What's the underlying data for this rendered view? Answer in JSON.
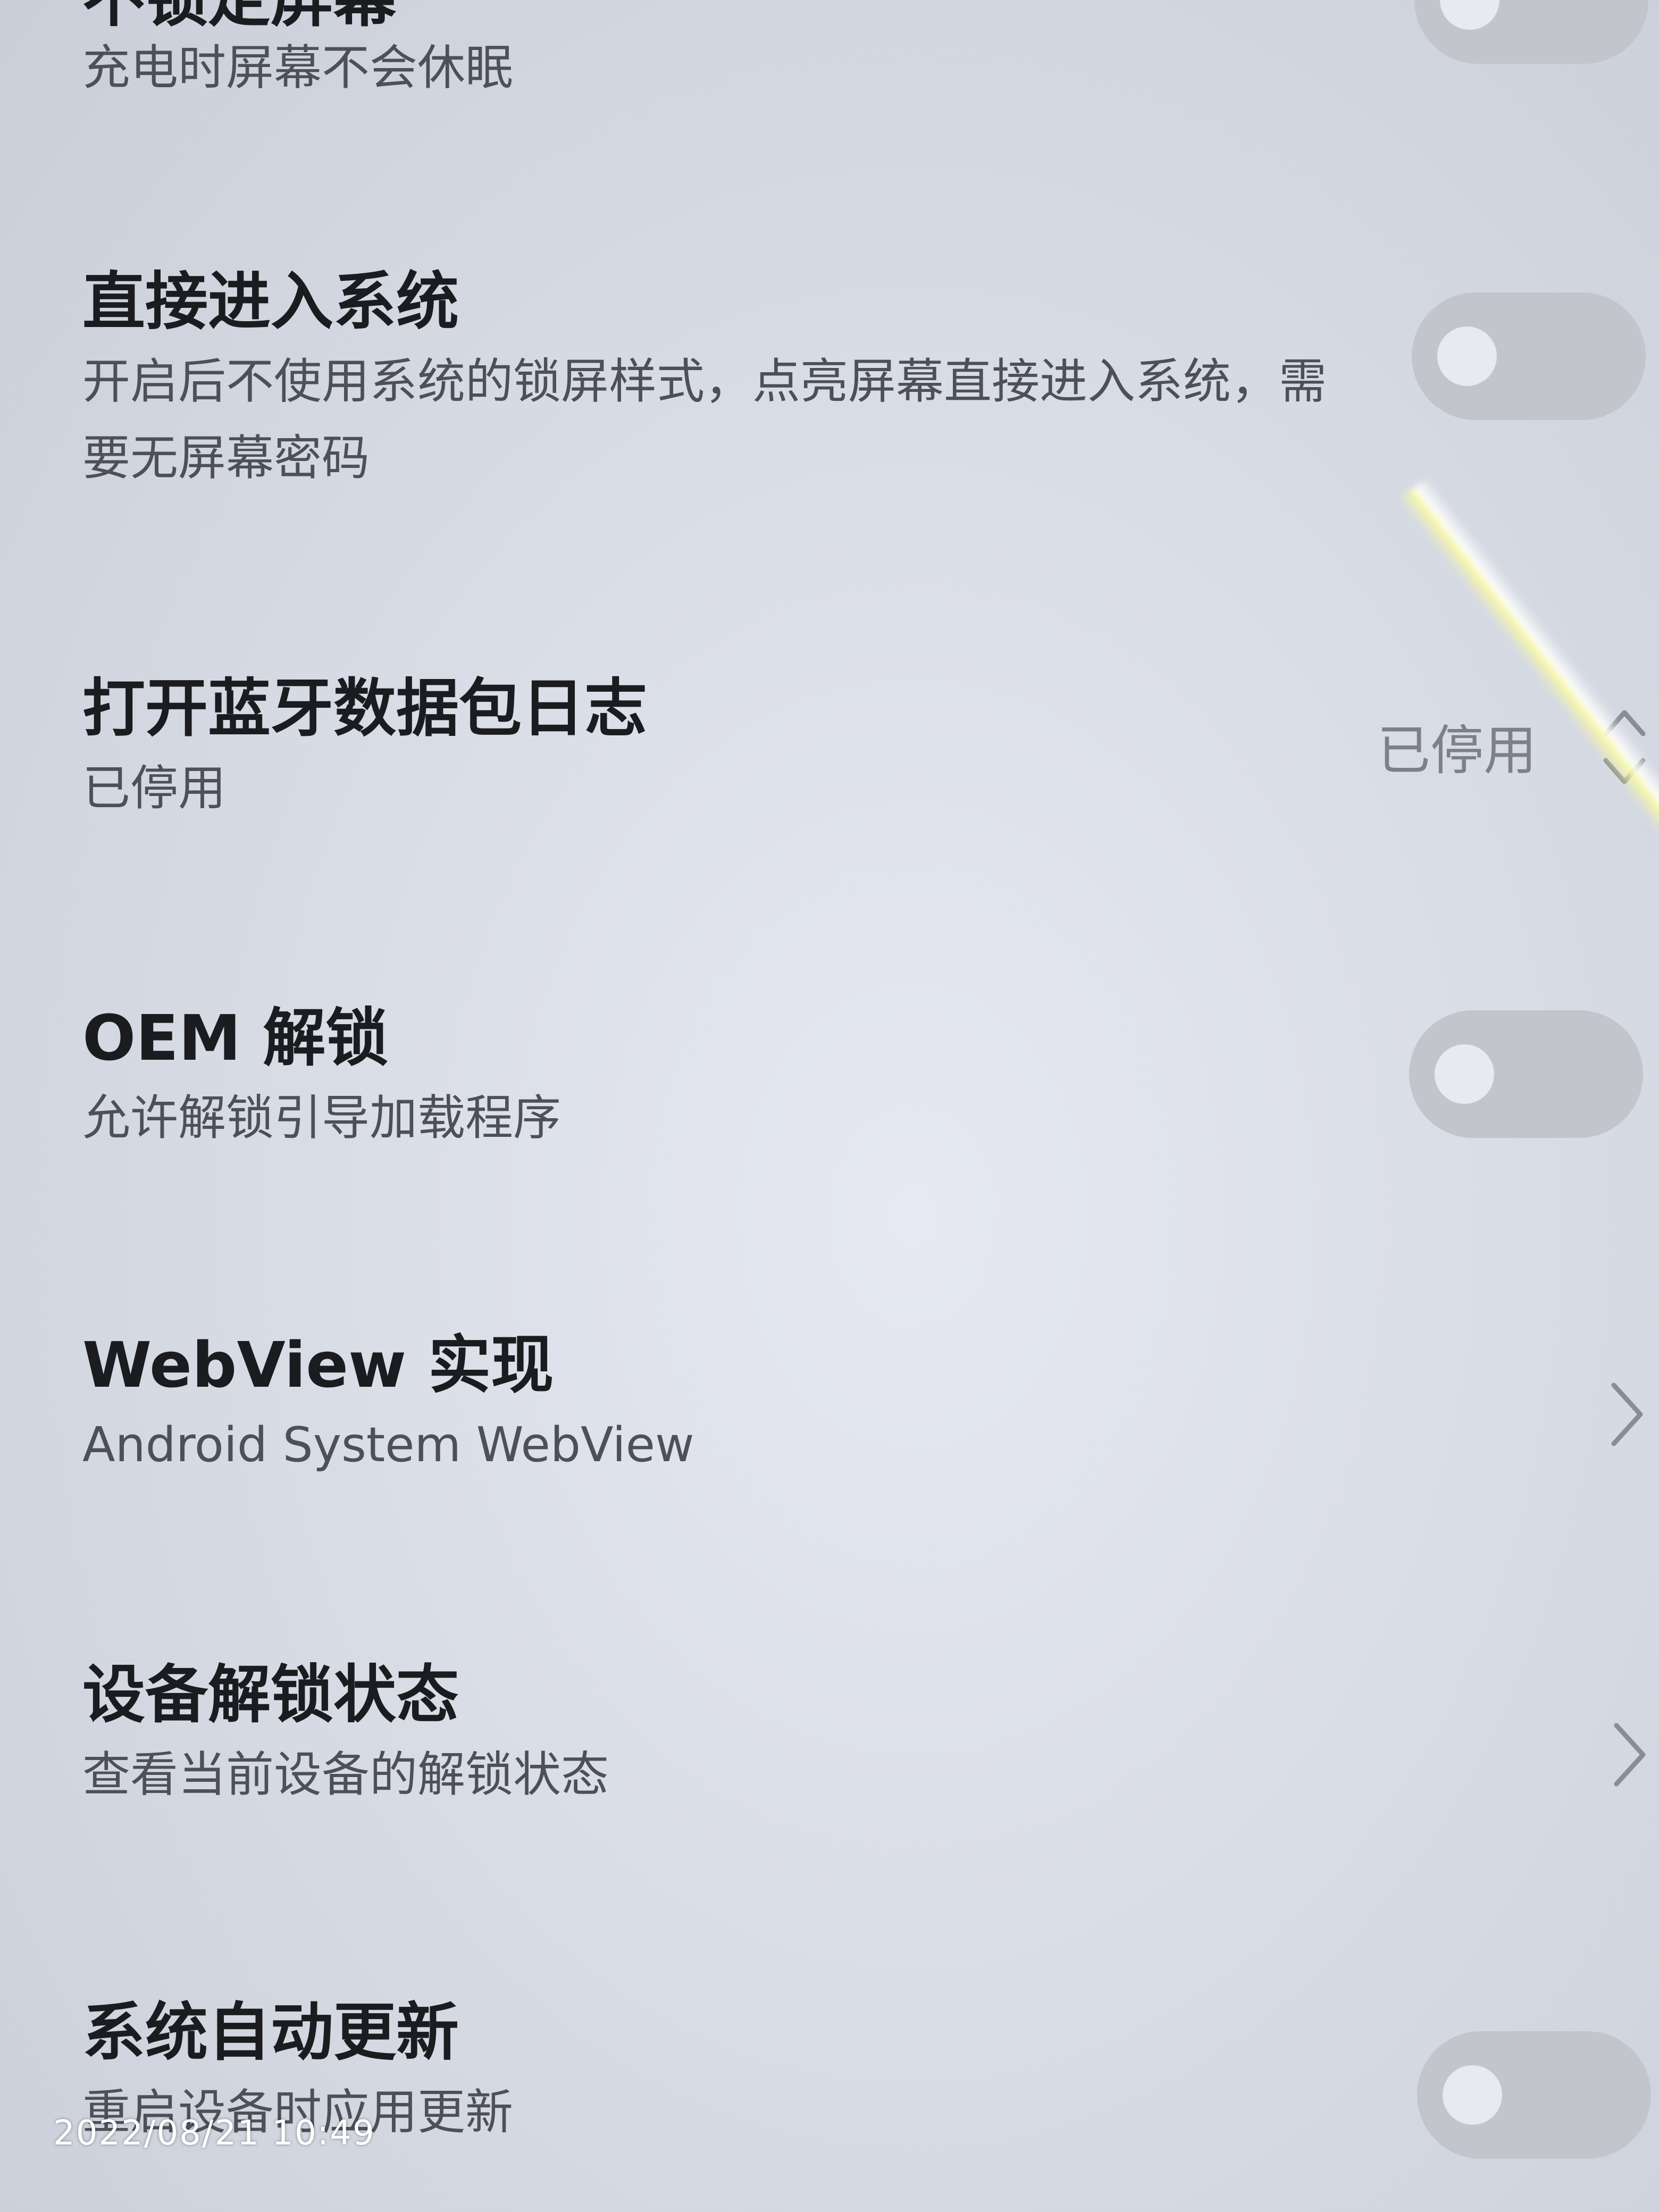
{
  "settings": {
    "stay_awake": {
      "title": "不锁定屏幕",
      "subtitle": "充电时屏幕不会休眠",
      "switch_on": false
    },
    "direct_boot": {
      "title": "直接进入系统",
      "subtitle": "开启后不使用系统的锁屏样式，点亮屏幕直接进入系统，需要无屏幕密码",
      "switch_on": false
    },
    "bt_hci_log": {
      "title": "打开蓝牙数据包日志",
      "subtitle": "已停用",
      "value": "已停用",
      "icon": "updown-icon"
    },
    "oem_unlock": {
      "title": "OEM 解锁",
      "subtitle": "允许解锁引导加载程序",
      "switch_on": false
    },
    "webview": {
      "title": "WebView 实现",
      "subtitle": "Android System WebView",
      "icon": "chevron-right-icon"
    },
    "device_unlock_status": {
      "title": "设备解锁状态",
      "subtitle": "查看当前设备的解锁状态",
      "icon": "chevron-right-icon"
    },
    "system_auto_update": {
      "title": "系统自动更新",
      "subtitle": "重启设备时应用更新",
      "switch_on": false
    }
  },
  "watermark": {
    "timestamp": "2022/08/21 10:49"
  },
  "colors": {
    "switch_track": "#c2c5cc",
    "switch_knob": "#e8eaef",
    "title_text": "#1b1c20",
    "subtitle_text": "#4d5058"
  }
}
